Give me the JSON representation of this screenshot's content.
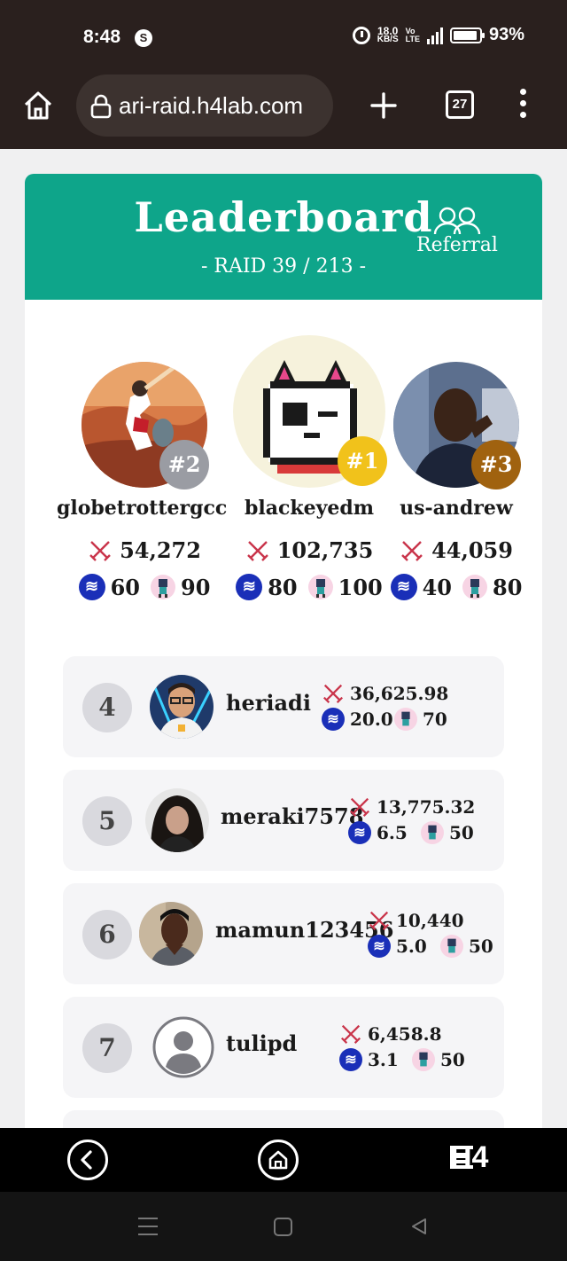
{
  "status_bar": {
    "time": "8:48",
    "app_badge": "S",
    "net_speed": "18.0",
    "net_unit": "KB/S",
    "volte": "Vo\nLTE",
    "battery_percent": "93%"
  },
  "browser": {
    "url": "ari-raid.h4lab.com",
    "tab_count": "27"
  },
  "leaderboard": {
    "title": "Leaderboard",
    "raid": "- RAID 39 / 213 -",
    "referral_label": "Referral"
  },
  "podium": [
    {
      "badge": "#2",
      "name": "globetrottergcc",
      "score": "54,272",
      "steem": "60",
      "raider": "90",
      "badge_color": "#9a9ca3"
    },
    {
      "badge": "#1",
      "name": "blackeyedm",
      "score": "102,735",
      "steem": "80",
      "raider": "100",
      "badge_color": "#f1c21b"
    },
    {
      "badge": "#3",
      "name": "us-andrew",
      "score": "44,059",
      "steem": "40",
      "raider": "80",
      "badge_color": "#a0620f"
    }
  ],
  "ranking": [
    {
      "rank": "4",
      "name": "heriadi",
      "score": "36,625.98",
      "steem": "20.0",
      "raider": "70"
    },
    {
      "rank": "5",
      "name": "meraki7578",
      "score": "13,775.32",
      "steem": "6.5",
      "raider": "50"
    },
    {
      "rank": "6",
      "name": "mamun123456",
      "score": "10,440",
      "steem": "5.0",
      "raider": "50"
    },
    {
      "rank": "7",
      "name": "tulipd",
      "score": "6,458.8",
      "steem": "3.1",
      "raider": "50"
    }
  ],
  "app_nav": {
    "brand": "H4"
  },
  "colors": {
    "header_teal": "#0ea58a",
    "steem_blue": "#1a2fb8",
    "sword_red": "#c9344a"
  },
  "icons": [
    "home-icon",
    "lock-icon",
    "plus-icon",
    "tabs-icon",
    "menu-icon",
    "referral-icon",
    "sword-icon",
    "steem-icon",
    "raider-icon",
    "back-icon",
    "brand-logo"
  ]
}
